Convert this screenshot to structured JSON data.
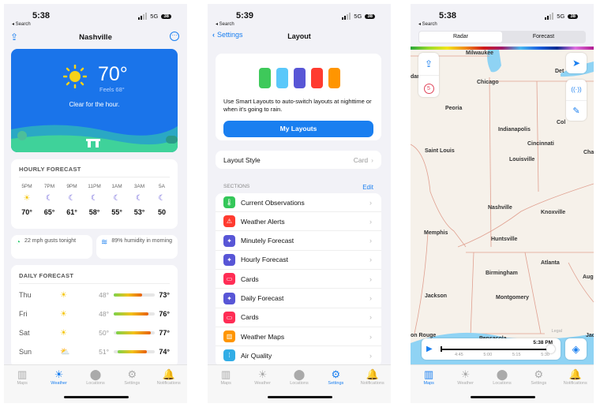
{
  "status": [
    {
      "time": "5:38",
      "back": "◂ Search",
      "network": "5G",
      "battery": "38"
    },
    {
      "time": "5:39",
      "back": "◂ Search",
      "network": "5G",
      "battery": "38"
    },
    {
      "time": "5:38",
      "back": "◂ Search",
      "network": "5G",
      "battery": "38"
    }
  ],
  "tabs": [
    {
      "label": "Maps",
      "icon": "map-icon",
      "glyph": "▥"
    },
    {
      "label": "Weather",
      "icon": "sun-icon",
      "glyph": "☀"
    },
    {
      "label": "Locations",
      "icon": "location-pin-icon",
      "glyph": "⬤"
    },
    {
      "label": "Settings",
      "icon": "gear-icon",
      "glyph": "⚙"
    },
    {
      "label": "Notifications",
      "icon": "bell-icon",
      "glyph": "🔔"
    }
  ],
  "weather": {
    "city": "Nashville",
    "temp": "70°",
    "feels": "Feels 68°",
    "summary": "Clear for the hour.",
    "hourly_title": "HOURLY FORECAST",
    "hourly": [
      {
        "time": "5PM",
        "icon": "sun-icon",
        "temp": "70°"
      },
      {
        "time": "7PM",
        "icon": "moon-icon",
        "temp": "65°"
      },
      {
        "time": "9PM",
        "icon": "moon-icon",
        "temp": "61°"
      },
      {
        "time": "11PM",
        "icon": "moon-icon",
        "temp": "58°"
      },
      {
        "time": "1AM",
        "icon": "moon-icon",
        "temp": "55°"
      },
      {
        "time": "3AM",
        "icon": "moon-icon",
        "temp": "53°"
      },
      {
        "time": "5A",
        "icon": "moon-icon",
        "temp": "50"
      }
    ],
    "gusts": "22 mph gusts tonight",
    "humidity": "89% humidity in morning",
    "daily_title": "DAILY FORECAST",
    "daily": [
      {
        "day": "Thu",
        "icon": "sun-icon",
        "low": "48°",
        "high": "73°",
        "range": [
          0.0,
          0.7
        ]
      },
      {
        "day": "Fri",
        "icon": "sun-icon",
        "low": "48°",
        "high": "76°",
        "range": [
          0.0,
          0.85
        ]
      },
      {
        "day": "Sat",
        "icon": "sun-icon",
        "low": "50°",
        "high": "77°",
        "range": [
          0.05,
          0.9
        ]
      },
      {
        "day": "Sun",
        "icon": "partly-cloudy-icon",
        "low": "51°",
        "high": "74°",
        "range": [
          0.1,
          0.8
        ]
      }
    ]
  },
  "layout": {
    "back": "Settings",
    "title": "Layout",
    "swatches": [
      "#3ec95a",
      "#5ac8fa",
      "#5856d6",
      "#ff3b30",
      "#ff9500"
    ],
    "description": "Use Smart Layouts to auto-switch layouts at nighttime or when it's going to rain.",
    "my_layouts": "My Layouts",
    "style_label": "Layout Style",
    "style_value": "Card",
    "sections_title": "SECTIONS",
    "edit": "Edit",
    "sections": [
      {
        "label": "Current Observations",
        "color": "#34c759",
        "icon": "thermometer-icon",
        "glyph": "🌡"
      },
      {
        "label": "Weather Alerts",
        "color": "#ff3b30",
        "icon": "warning-icon",
        "glyph": "⚠"
      },
      {
        "label": "Minutely Forecast",
        "color": "#5856d6",
        "icon": "sparkle-icon",
        "glyph": "✦"
      },
      {
        "label": "Hourly Forecast",
        "color": "#5856d6",
        "icon": "sparkle-icon",
        "glyph": "✦"
      },
      {
        "label": "Cards",
        "color": "#ff2d55",
        "icon": "cards-icon",
        "glyph": "▭"
      },
      {
        "label": "Daily Forecast",
        "color": "#5856d6",
        "icon": "sparkle-icon",
        "glyph": "✦"
      },
      {
        "label": "Cards",
        "color": "#ff2d55",
        "icon": "cards-icon",
        "glyph": "▭"
      },
      {
        "label": "Weather Maps",
        "color": "#ff9500",
        "icon": "map-icon",
        "glyph": "▥"
      },
      {
        "label": "Air Quality",
        "color": "#32ade6",
        "icon": "air-quality-icon",
        "glyph": "⁞"
      }
    ]
  },
  "radar": {
    "seg": [
      "Radar",
      "Forecast"
    ],
    "selected": "Radar",
    "cities": [
      {
        "name": "Milwaukee"
      },
      {
        "name": "Chicago"
      },
      {
        "name": "Det"
      },
      {
        "name": "dar Rapids"
      },
      {
        "name": "Peoria"
      },
      {
        "name": "Indianapolis"
      },
      {
        "name": "Col"
      },
      {
        "name": "Cincinnati"
      },
      {
        "name": "Saint Louis"
      },
      {
        "name": "Louisville"
      },
      {
        "name": "Charl"
      },
      {
        "name": "Nashville"
      },
      {
        "name": "Knoxville"
      },
      {
        "name": "Memphis"
      },
      {
        "name": "Huntsville"
      },
      {
        "name": "Atlanta"
      },
      {
        "name": "Aug"
      },
      {
        "name": "Birmingham"
      },
      {
        "name": "Jackson"
      },
      {
        "name": "Montgomery"
      },
      {
        "name": "on Rouge"
      },
      {
        "name": "Pensacola"
      },
      {
        "name": "Jacl"
      }
    ],
    "legal": "Legal",
    "badge": "5",
    "current_time": "5:38 PM",
    "ticks": [
      "4:45",
      "5:00",
      "5:15",
      "5:30"
    ]
  }
}
